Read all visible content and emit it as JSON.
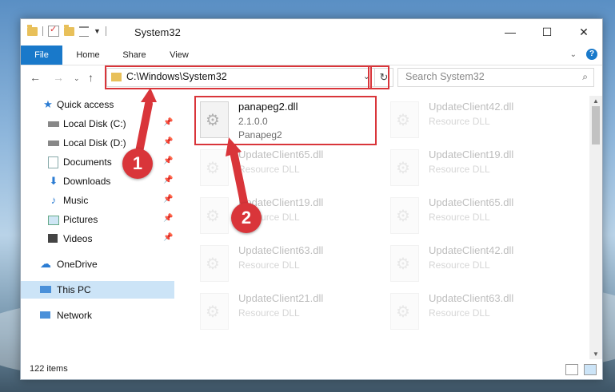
{
  "window": {
    "title": "System32"
  },
  "ribbon": {
    "tabs": [
      "File",
      "Home",
      "Share",
      "View"
    ],
    "help": "?"
  },
  "nav": {
    "address": "C:\\Windows\\System32",
    "search_placeholder": "Search System32"
  },
  "sidebar": {
    "items": [
      {
        "label": "Quick access",
        "icon": "star-icon"
      },
      {
        "label": "Local Disk (C:)",
        "icon": "drive-icon",
        "pinned": true
      },
      {
        "label": "Local Disk (D:)",
        "icon": "drive-icon",
        "pinned": true
      },
      {
        "label": "Documents",
        "icon": "documents-icon",
        "pinned": true
      },
      {
        "label": "Downloads",
        "icon": "downloads-icon",
        "pinned": true
      },
      {
        "label": "Music",
        "icon": "music-icon",
        "pinned": true
      },
      {
        "label": "Pictures",
        "icon": "pictures-icon",
        "pinned": true
      },
      {
        "label": "Videos",
        "icon": "videos-icon",
        "pinned": true
      },
      {
        "label": "OneDrive",
        "icon": "cloud-icon"
      },
      {
        "label": "This PC",
        "icon": "pc-icon",
        "selected": true
      },
      {
        "label": "Network",
        "icon": "network-icon"
      }
    ]
  },
  "files": {
    "highlighted": {
      "name": "panapeg2.dll",
      "version": "2.1.0.0",
      "description": "Panapeg2"
    },
    "left_column": [
      {
        "name": "UpdateClient65.dll",
        "type": "Resource DLL"
      },
      {
        "name": "UpdateClient19.dll",
        "type": "Resource DLL"
      },
      {
        "name": "UpdateClient63.dll",
        "type": "Resource DLL"
      },
      {
        "name": "UpdateClient21.dll",
        "type": "Resource DLL"
      }
    ],
    "right_column": [
      {
        "name": "UpdateClient42.dll",
        "type": "Resource DLL"
      },
      {
        "name": "UpdateClient19.dll",
        "type": "Resource DLL"
      },
      {
        "name": "UpdateClient65.dll",
        "type": "Resource DLL"
      },
      {
        "name": "UpdateClient42.dll",
        "type": "Resource DLL"
      },
      {
        "name": "UpdateClient63.dll",
        "type": "Resource DLL"
      }
    ]
  },
  "status": {
    "item_count": "122 items"
  },
  "annotations": {
    "step1": "1",
    "step2": "2",
    "color": "#d9353a"
  }
}
